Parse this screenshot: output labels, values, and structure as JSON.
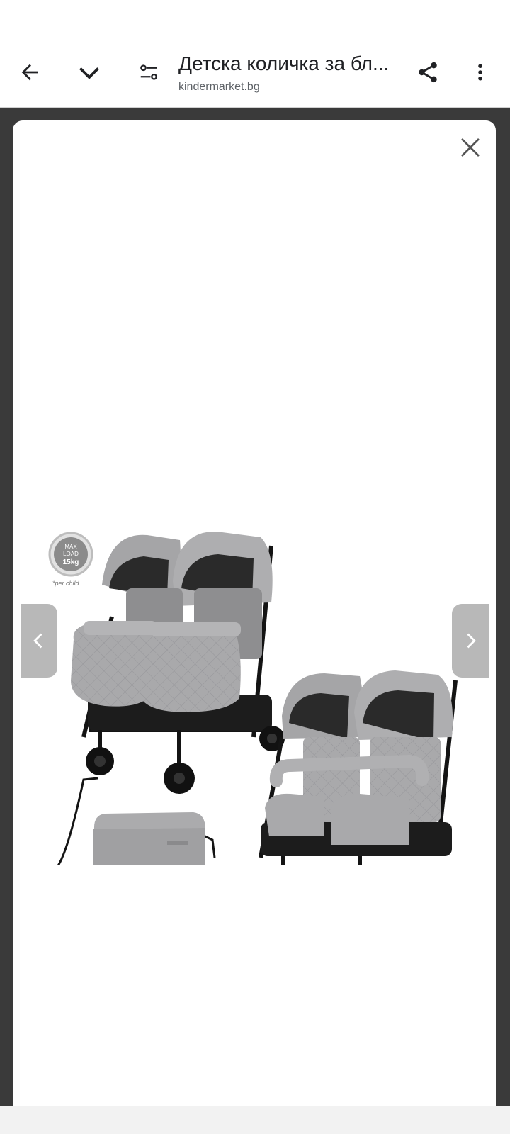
{
  "header": {
    "back_icon": "arrow-left-icon",
    "collapse_icon": "chevron-down-icon",
    "settings_icon": "tune-icon",
    "title": "Детска количка за бл...",
    "url": "kindermarket.bg",
    "share_icon": "share-icon",
    "more_icon": "more-vert-icon"
  },
  "viewer": {
    "close_icon": "close-icon",
    "prev_icon": "chevron-left-icon",
    "next_icon": "chevron-right-icon",
    "badge": {
      "line1": "MAX",
      "line2": "LOAD",
      "line3": "15kg",
      "caption": "*per child"
    }
  },
  "colors": {
    "fabric": "#a9a9ab",
    "fabric_dark": "#8e8e90",
    "frame": "#141414",
    "backdrop": "#3a3a3a"
  }
}
